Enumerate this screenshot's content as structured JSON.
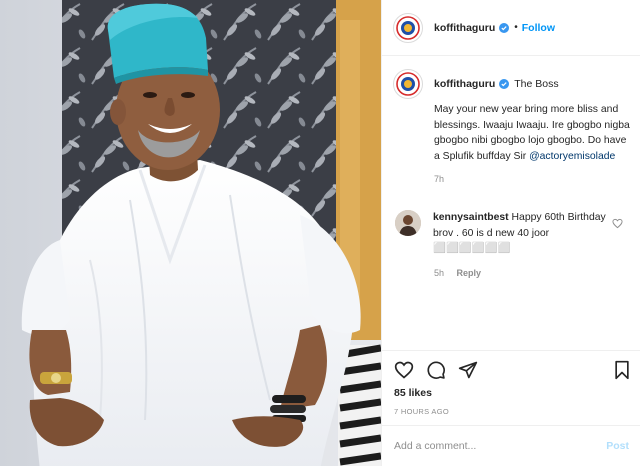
{
  "header": {
    "username": "koffithaguru",
    "separator": "•",
    "follow_label": "Follow"
  },
  "caption": {
    "username": "koffithaguru",
    "lead": "The Boss",
    "body": "May your new year bring more bliss and blessings. Iwaaju Iwaaju. Ire gbogbo nigba gbogbo nibi gbogbo lojo gbogbo. Do have a Splufik buffday Sir ",
    "mention": "@actoryemisolade",
    "time": "7h"
  },
  "comment": {
    "username": "kennysaintbest",
    "text": "Happy 60th Birthday brov . 60 is d new 40 joor ⬜⬜⬜⬜⬜⬜",
    "time": "5h",
    "reply_label": "Reply"
  },
  "actions": {
    "icons": [
      "heart-icon",
      "comment-icon",
      "share-icon",
      "bookmark-icon"
    ],
    "likes": "85 likes",
    "posted_ago": "7 HOURS AGO"
  },
  "add_comment": {
    "placeholder": "Add a comment...",
    "post_label": "Post"
  },
  "colors": {
    "link_blue": "#0095f6",
    "mention_blue": "#00376b",
    "muted": "#8e8e8e",
    "post_disabled": "#b2dffc",
    "verified": "#3897f0",
    "cap_teal": "#2fb7c9"
  }
}
